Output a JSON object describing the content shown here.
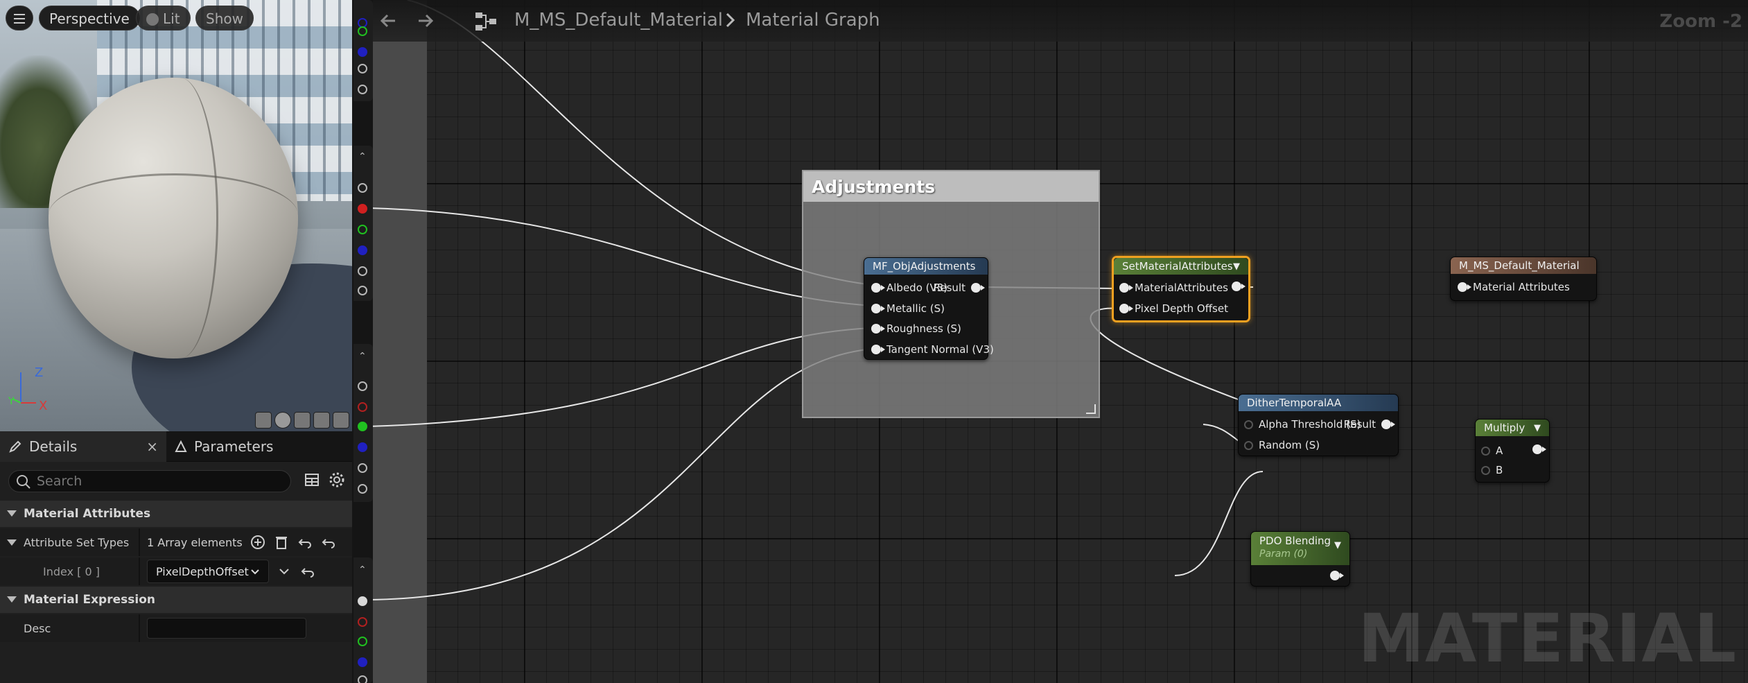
{
  "viewport": {
    "perspective_label": "Perspective",
    "lit_label": "Lit",
    "show_label": "Show",
    "axis_z": "Z",
    "axis_x": "X",
    "axis_y": "Y"
  },
  "details_panel": {
    "tabs": [
      {
        "label": "Details",
        "active": true
      },
      {
        "label": "Parameters",
        "active": false
      }
    ],
    "close_glyph": "×",
    "search_placeholder": "Search",
    "categories": [
      {
        "label": "Material Attributes"
      },
      {
        "label": "Material Expression"
      }
    ],
    "properties": {
      "attribute_set_types": {
        "label": "Attribute Set Types",
        "value": "1 Array elements"
      },
      "index_0": {
        "label": "Index [ 0 ]",
        "value": "PixelDepthOffset"
      },
      "desc": {
        "label": "Desc",
        "value": ""
      }
    }
  },
  "graph": {
    "breadcrumb": {
      "asset": "M_MS_Default_Material",
      "graph": "Material Graph"
    },
    "zoom_label": "Zoom -2",
    "watermark": "MATERIAL",
    "comment_box": {
      "title": "Adjustments"
    },
    "nodes": {
      "mf_obj_adjustments": {
        "title": "MF_ObjAdjustments",
        "inputs": [
          "Albedo (V3)",
          "Metallic (S)",
          "Roughness (S)",
          "Tangent Normal (V3)"
        ],
        "output": "Result"
      },
      "set_material_attributes": {
        "title": "SetMaterialAttributes",
        "inputs": [
          "MaterialAttributes",
          "Pixel Depth Offset"
        ],
        "border_color": "#f0a020"
      },
      "result_node": {
        "title": "M_MS_Default_Material",
        "inputs": [
          "Material Attributes"
        ]
      },
      "dither_temporal_aa": {
        "title": "DitherTemporalAA",
        "inputs": [
          "Alpha Threshold (S)",
          "Random (S)"
        ],
        "output": "Result"
      },
      "multiply": {
        "title": "Multiply",
        "inputs": [
          "A",
          "B"
        ]
      },
      "pdo_blending": {
        "title": "PDO Blending",
        "subtitle": "Param (0)"
      }
    }
  },
  "colors": {
    "selection": "#f0a020",
    "function_header": "#4a6e92",
    "math_header": "#5a8038",
    "result_header": "#8a6450"
  }
}
